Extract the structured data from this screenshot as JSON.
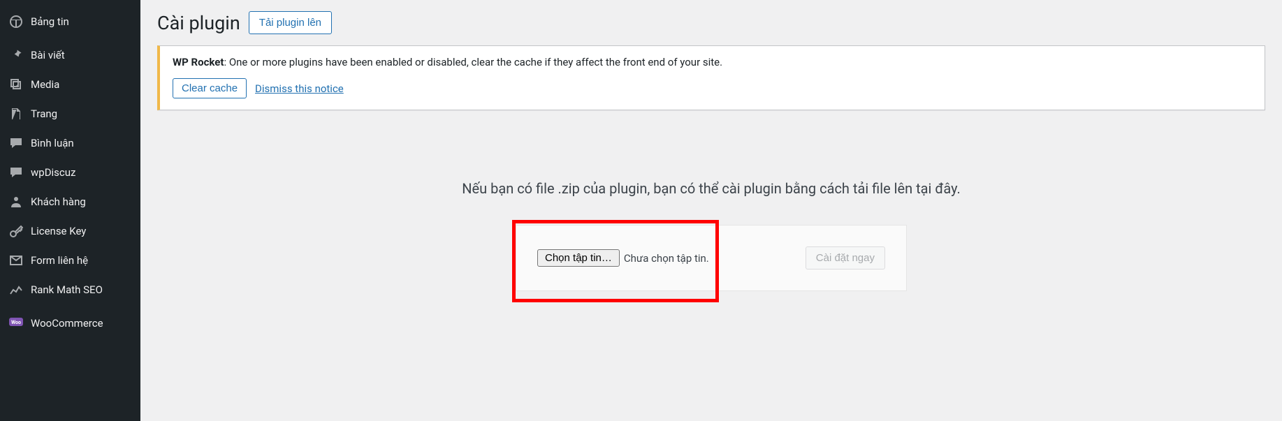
{
  "sidebar": {
    "items": [
      {
        "label": "Bảng tin"
      },
      {
        "label": "Bài viết"
      },
      {
        "label": "Media"
      },
      {
        "label": "Trang"
      },
      {
        "label": "Bình luận"
      },
      {
        "label": "wpDiscuz"
      },
      {
        "label": "Khách hàng"
      },
      {
        "label": "License Key"
      },
      {
        "label": "Form liên hệ"
      },
      {
        "label": "Rank Math SEO"
      },
      {
        "label": "WooCommerce"
      }
    ]
  },
  "header": {
    "title": "Cài plugin",
    "upload_button": "Tải plugin lên"
  },
  "notice": {
    "strong": "WP Rocket",
    "text": ": One or more plugins have been enabled or disabled, clear the cache if they affect the front end of your site.",
    "clear_cache": "Clear cache",
    "dismiss": "Dismiss this notice"
  },
  "upload": {
    "instructions": "Nếu bạn có file .zip của plugin, bạn có thể cài plugin bằng cách tải file lên tại đây.",
    "choose_file": "Chọn tập tin…",
    "no_file": "Chưa chọn tập tin.",
    "install_now": "Cài đặt ngay"
  }
}
